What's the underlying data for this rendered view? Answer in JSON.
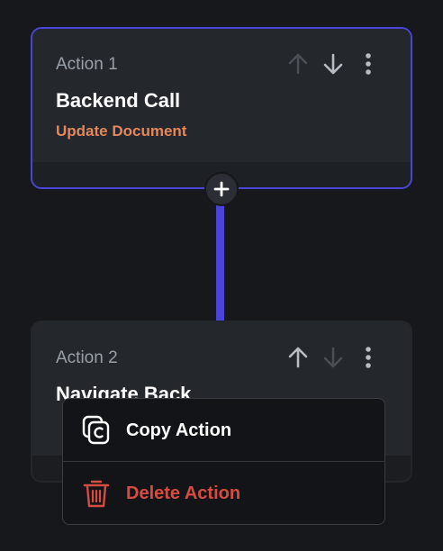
{
  "actions": [
    {
      "label": "Action 1",
      "title": "Backend Call",
      "subtitle": "Update Document",
      "controls": {
        "move_up": {
          "icon": "arrow-up-icon",
          "enabled": false
        },
        "move_down": {
          "icon": "arrow-down-icon",
          "enabled": true
        },
        "more": {
          "icon": "more-vertical-icon"
        }
      }
    },
    {
      "label": "Action 2",
      "title": "Navigate Back",
      "controls": {
        "move_up": {
          "icon": "arrow-up-icon",
          "enabled": true
        },
        "move_down": {
          "icon": "arrow-down-icon",
          "enabled": false
        },
        "more": {
          "icon": "more-vertical-icon"
        }
      }
    }
  ],
  "add_action": {
    "icon": "plus-icon"
  },
  "context_menu": {
    "items": [
      {
        "label": "Copy Action",
        "icon": "copy-icon",
        "color": "#ffffff"
      },
      {
        "label": "Delete Action",
        "icon": "trash-icon",
        "color": "#d54c43"
      }
    ]
  },
  "colors": {
    "accent": "#4b44d6",
    "subtitle": "#e5875b",
    "danger": "#d54c43"
  }
}
